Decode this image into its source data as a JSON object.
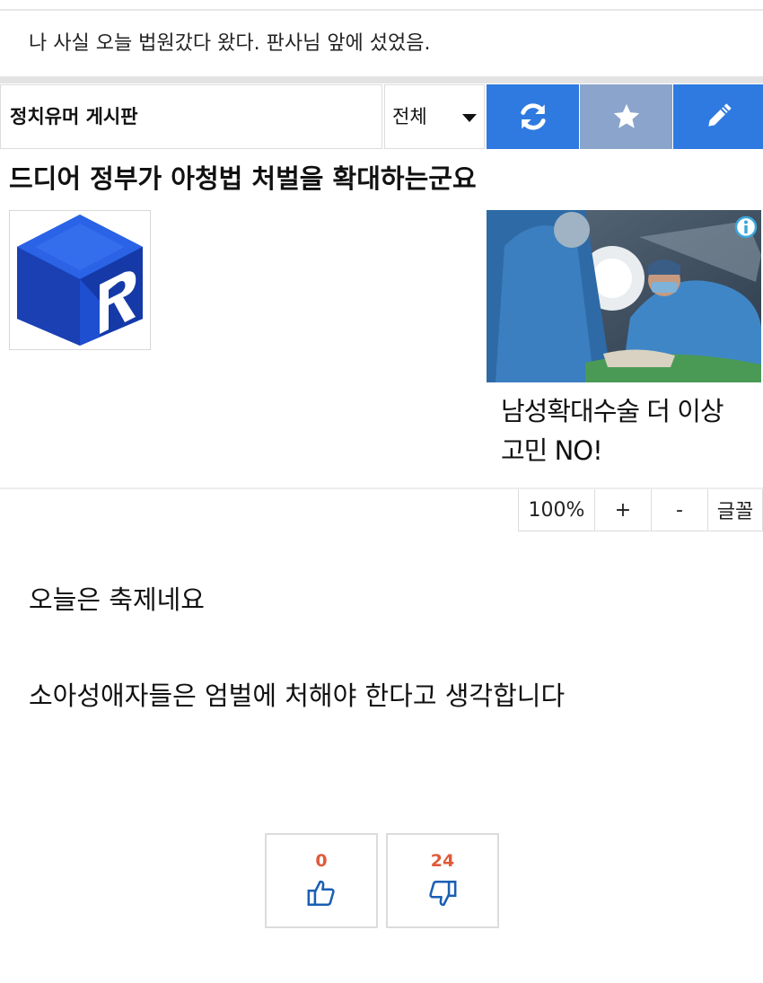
{
  "prev_post": {
    "title": "나 사실 오늘 법원갔다 왔다. 판사님 앞에 섰었음."
  },
  "board": {
    "name": "정치유머 게시판",
    "filter_selected": "전체",
    "buttons": {
      "refresh_icon": "refresh-icon",
      "star_icon": "star-icon",
      "write_icon": "pencil-icon"
    },
    "colors": {
      "primary": "#2f7ae0",
      "star_bg": "#8aa4cc"
    }
  },
  "post": {
    "title": "드디어 정부가 아청법 처벌을 확대하는군요",
    "paragraphs": [
      "오늘은 축제네요",
      "소아성애자들은 엄벌에 처해야 한다고 생각합니다"
    ]
  },
  "ad": {
    "text": "남성확대수술 더 이상 고민 NO!",
    "info_icon": "info-icon"
  },
  "font_tools": {
    "zoom": "100%",
    "plus": "+",
    "minus": "-",
    "font": "글꼴"
  },
  "votes": {
    "up_count": "0",
    "down_count": "24",
    "up_icon": "thumbs-up-icon",
    "down_icon": "thumbs-down-icon",
    "count_color": "#e05a3a"
  }
}
